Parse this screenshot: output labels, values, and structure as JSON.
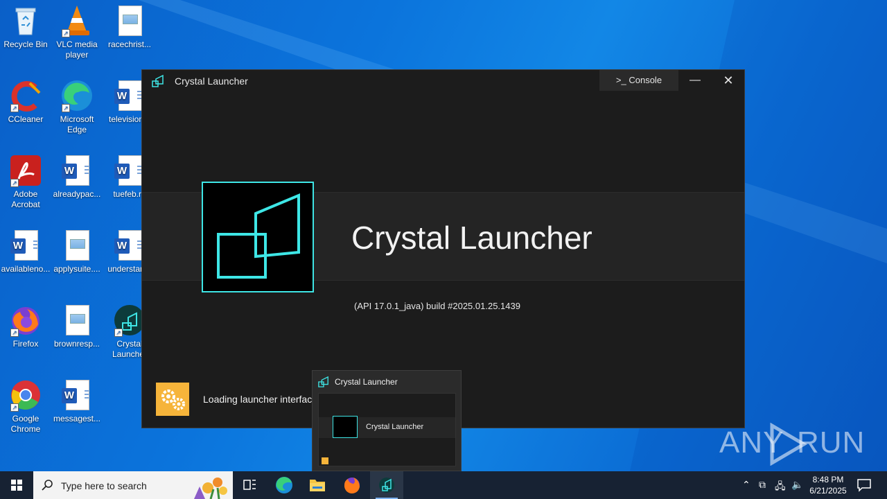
{
  "desktop": {
    "icons": [
      {
        "label": "Recycle Bin"
      },
      {
        "label": "VLC media player"
      },
      {
        "label": "racechrist..."
      },
      {
        "label": "CCleaner"
      },
      {
        "label": "Microsoft Edge"
      },
      {
        "label": "television..."
      },
      {
        "label": "Adobe Acrobat"
      },
      {
        "label": "alreadypac..."
      },
      {
        "label": "tuefeb.rtf"
      },
      {
        "label": "availableno..."
      },
      {
        "label": "applysuite...."
      },
      {
        "label": "understan..."
      },
      {
        "label": "Firefox"
      },
      {
        "label": "brownresp..."
      },
      {
        "label": "Crystal Launcher"
      },
      {
        "label": "Google Chrome"
      },
      {
        "label": "messagest..."
      }
    ]
  },
  "launcher_window": {
    "title": "Crystal Launcher",
    "console_label": ">_ Console",
    "minimize_glyph": "—",
    "close_glyph": "✕",
    "app_name": "Crystal Launcher",
    "build_info": "(API 17.0.1_java) build #2025.01.25.1439",
    "status_text": "Loading launcher interface...",
    "accent_color": "#3ee6e6",
    "status_tile_color": "#f6b43a"
  },
  "taskbar_preview": {
    "title": "Crystal Launcher",
    "mini_app_name": "Crystal Launcher"
  },
  "watermark": {
    "left": "ANY",
    "right": "RUN"
  },
  "taskbar": {
    "search_placeholder": "Type here to search",
    "apps": [
      "task-view",
      "edge",
      "file-explorer",
      "firefox",
      "crystal-launcher"
    ],
    "clock_time": "8:48 PM",
    "clock_date": "6/21/2025"
  }
}
